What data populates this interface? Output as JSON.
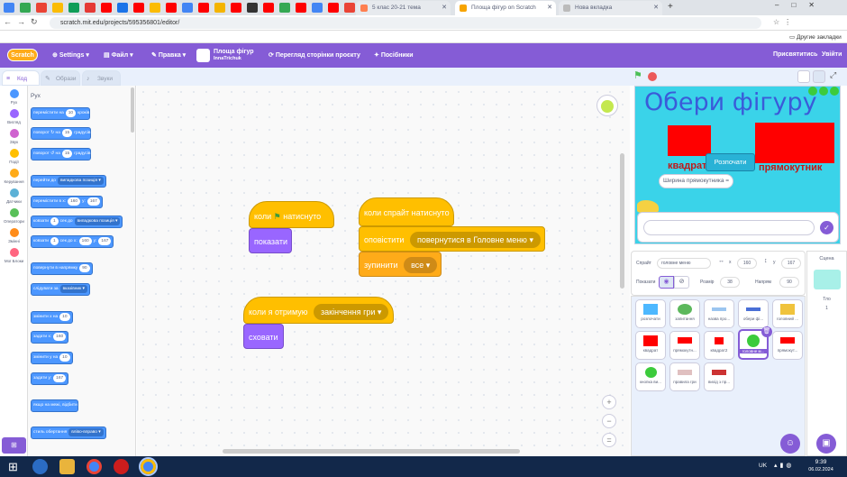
{
  "browser": {
    "tabs": [
      {
        "label": "5 клас 20-21 тема",
        "active": false
      },
      {
        "label": "Площа фігур on Scratch",
        "active": true
      },
      {
        "label": "Нова вкладка",
        "active": false
      }
    ],
    "url": "scratch.mit.edu/projects/595356801/editor/",
    "bookmarks_other": "Другие закладки"
  },
  "menubar": {
    "logo": "Scratch",
    "settings": "Settings",
    "file": "Файл",
    "edit": "Правка",
    "project_title": "Площа фігур",
    "author": "InnaTrichuk",
    "see_project": "Перегляд сторінки проєкту",
    "tutorials": "Посібники",
    "remix": "Присвятитись",
    "signin": "Увійти"
  },
  "editor_tabs": {
    "code": "Код",
    "costumes": "Образи",
    "sounds": "Звуки"
  },
  "categories": [
    {
      "label": "Рух",
      "color": "#4c97ff"
    },
    {
      "label": "Вигляд",
      "color": "#9966ff"
    },
    {
      "label": "Звук",
      "color": "#cf63cf"
    },
    {
      "label": "Події",
      "color": "#ffbf00"
    },
    {
      "label": "Керування",
      "color": "#ffab19"
    },
    {
      "label": "Датчики",
      "color": "#5cb1d6"
    },
    {
      "label": "Оператори",
      "color": "#59c059"
    },
    {
      "label": "Змінні",
      "color": "#ff8c1a"
    },
    {
      "label": "Мої Блоки",
      "color": "#ff6680"
    }
  ],
  "palette": {
    "heading": "Рух",
    "blocks": [
      {
        "text": "перемістити на",
        "val": "10",
        "tail": "кроків"
      },
      {
        "text": "поворот ↻ на",
        "val": "15",
        "tail": "градусів"
      },
      {
        "text": "поворот ↺ на",
        "val": "15",
        "tail": "градусів"
      },
      {
        "text": "перейти до",
        "drop": "випадкова позиція"
      },
      {
        "text": "перемістити в x:",
        "val": "160",
        "mid": "y:",
        "val2": "167"
      },
      {
        "text": "ковзати",
        "val": "1",
        "mid": "сек до",
        "drop": "випадкова позиція"
      },
      {
        "text": "ковзати",
        "val": "1",
        "mid": "сек до x:",
        "val2": "160",
        "mid2": "y:",
        "val3": "167"
      },
      {
        "text": "повернути в напрямку",
        "val": "90"
      },
      {
        "text": "слідувати за",
        "drop": "вказівник"
      },
      {
        "text": "змінити x на",
        "val": "10"
      },
      {
        "text": "задати x:",
        "val": "160"
      },
      {
        "text": "змінити y на",
        "val": "10"
      },
      {
        "text": "задати y:",
        "val": "167"
      },
      {
        "text": "якщо на межі, відбити"
      },
      {
        "text": "стиль обертання",
        "drop": "вліво-вправо"
      }
    ]
  },
  "scripts": {
    "flag_hat": {
      "pre": "коли",
      "post": "натиснуто"
    },
    "show": "показати",
    "sprite_hat": "коли спрайт натиснуто",
    "broadcast": "оповістити",
    "broadcast_msg": "повернутися в Головне меню",
    "stop": "зупинити",
    "stop_opt": "все",
    "receive_hat": "коли я отримую",
    "receive_msg": "закінчення гри",
    "hide": "сховати"
  },
  "zoom": {
    "in": "+",
    "out": "−",
    "reset": "="
  },
  "stage": {
    "title": "Обери фігуру",
    "label_square": "квадрат",
    "label_rect": "прямокутник",
    "start_button": "Розпочати",
    "variable": "Ширина прямокутника",
    "variable_suffix": "=",
    "answer": "",
    "check": "✓"
  },
  "sprite_info": {
    "sprite_label": "Спрайт",
    "sprite_name": "головне меню",
    "x_label": "x",
    "x": "160",
    "y_label": "y",
    "y": "167",
    "show_label": "Показати",
    "size_label": "Розмір",
    "size": "38",
    "dir_label": "Напрям",
    "dir": "90"
  },
  "sprites": [
    {
      "name": "розпочати",
      "color": "#4db8ff"
    },
    {
      "name": "запитання",
      "color": "#5cb85c"
    },
    {
      "name": "назва про...",
      "color": "#9bc5f0"
    },
    {
      "name": "обери фі...",
      "color": "#4a6fd6"
    },
    {
      "name": "головний ...",
      "color": "#f0c33c"
    },
    {
      "name": "квадрат",
      "color": "#ff0000"
    },
    {
      "name": "прямокутн...",
      "color": "#ff0000"
    },
    {
      "name": "квадрат2",
      "color": "#ff0000"
    },
    {
      "name": "головне м...",
      "color": "#3ccb3c",
      "selected": true
    },
    {
      "name": "прямокут...",
      "color": "#ff0000"
    },
    {
      "name": "кнопка ви...",
      "color": "#3ccb3c"
    },
    {
      "name": "правила гри",
      "color": "#e0c0c0"
    },
    {
      "name": "вихід з пр...",
      "color": "#cc3333"
    }
  ],
  "stage_panel": {
    "label": "Сцена",
    "backdrops_label": "Тло",
    "backdrops": "1"
  },
  "taskbar": {
    "lang": "UK",
    "time": "9:39",
    "date": "06.02.2024"
  }
}
